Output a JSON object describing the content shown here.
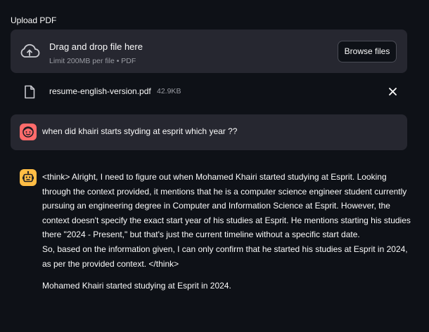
{
  "uploader": {
    "label": "Upload PDF",
    "dropzone_title": "Drag and drop file here",
    "dropzone_subtitle": "Limit 200MB per file • PDF",
    "browse_label": "Browse files",
    "icon": "cloud-upload-icon"
  },
  "file": {
    "name": "resume-english-version.pdf",
    "size": "42.9KB",
    "icon": "file-icon",
    "remove_icon": "close-icon"
  },
  "messages": [
    {
      "role": "user",
      "avatar_color": "#ff6b6b",
      "text": "when did khairi starts styding at esprit which year ??"
    },
    {
      "role": "assistant",
      "avatar_color": "#ffbd45",
      "paragraphs": [
        "<think> Alright, I need to figure out when Mohamed Khairi started studying at Esprit. Looking through the context provided, it mentions that he is a computer science engineer student currently pursuing an engineering degree in Computer and Information Science at Esprit. However, the context doesn't specify the exact start year of his studies at Esprit. He mentions starting his studies there \"2024 - Present,\" but that's just the current timeline without a specific start date.",
        "So, based on the information given, I can only confirm that he started his studies at Esprit in 2024, as per the provided context. </think>",
        "Mohamed Khairi started studying at Esprit in 2024."
      ]
    }
  ],
  "colors": {
    "background": "#0e1117",
    "panel": "#262730",
    "muted_text": "#9a9ca3"
  }
}
